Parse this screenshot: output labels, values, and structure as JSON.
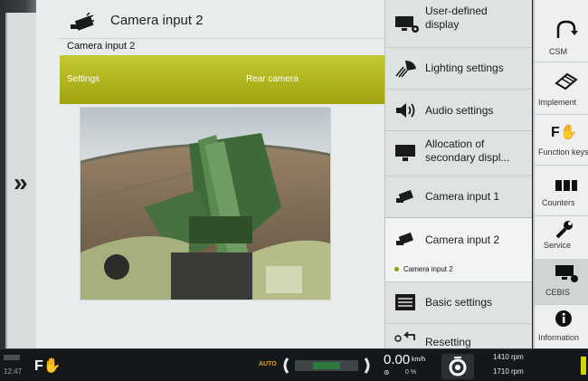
{
  "main": {
    "title": "Camera input 2",
    "subtitle": "Camera input 2",
    "bar_left": "Settings",
    "bar_right": "Rear camera"
  },
  "menu": {
    "items": [
      {
        "label": "User-defined display",
        "icon": "display-settings-icon"
      },
      {
        "label": "Lighting settings",
        "icon": "lighting-icon"
      },
      {
        "label": "Audio settings",
        "icon": "speaker-icon"
      },
      {
        "label": "Allocation of secondary displ...",
        "icon": "secondary-display-icon"
      },
      {
        "label": "Camera input 1",
        "icon": "camera-icon"
      },
      {
        "label": "Camera input 2",
        "icon": "camera-icon",
        "sub": "Camera input 2"
      },
      {
        "label": "Basic settings",
        "icon": "basic-settings-icon"
      },
      {
        "label": "Resetting",
        "icon": "reset-icon"
      }
    ]
  },
  "right": {
    "items": [
      {
        "label": "CSM",
        "icon": "csm-icon"
      },
      {
        "label": "Implement",
        "icon": "implement-icon"
      },
      {
        "label": "Function keys",
        "icon": "function-key-icon"
      },
      {
        "label": "Counters",
        "icon": "counters-icon"
      },
      {
        "label": "Service",
        "icon": "wrench-icon"
      },
      {
        "label": "CEBIS",
        "icon": "cebis-icon"
      },
      {
        "label": "Information",
        "icon": "info-icon"
      }
    ]
  },
  "status": {
    "time": "12:47",
    "auto": "AUTO",
    "speed": "0.00",
    "speed_unit": "km/h",
    "slip": "0 %",
    "rpm1": "1410 rpm",
    "rpm2": "1710 rpm"
  },
  "colors": {
    "accent": "#a9ae14",
    "status_bg": "#14181a"
  }
}
